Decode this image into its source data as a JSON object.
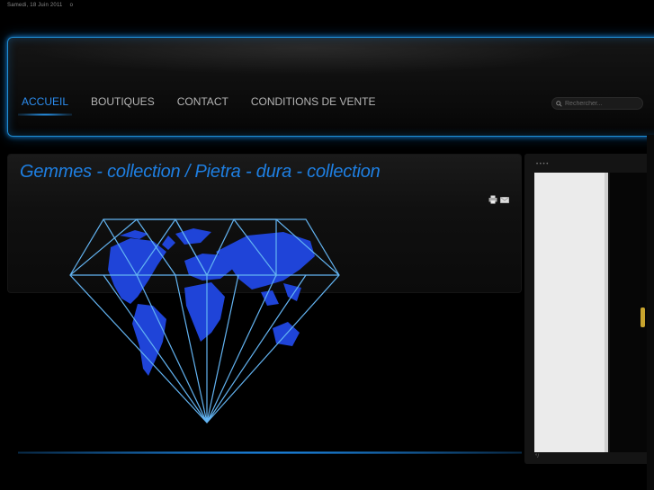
{
  "topbar": {
    "date": "Samedi, 18 Juin 2011",
    "extra": "o"
  },
  "nav": {
    "items": [
      {
        "label": "ACCUEIL",
        "active": true
      },
      {
        "label": "BOUTIQUES",
        "active": false
      },
      {
        "label": "CONTACT",
        "active": false
      },
      {
        "label": "CONDITIONS DE VENTE",
        "active": false
      }
    ]
  },
  "search": {
    "placeholder": "Rechercher..."
  },
  "main": {
    "title": "Gemmes - collection / Pietra - dura - collection"
  },
  "icons": {
    "print": "print-icon",
    "email": "email-icon",
    "search": "search-icon"
  },
  "colors": {
    "accent": "#1e7fe2",
    "glow": "#1f8fd6",
    "background": "#000000"
  }
}
